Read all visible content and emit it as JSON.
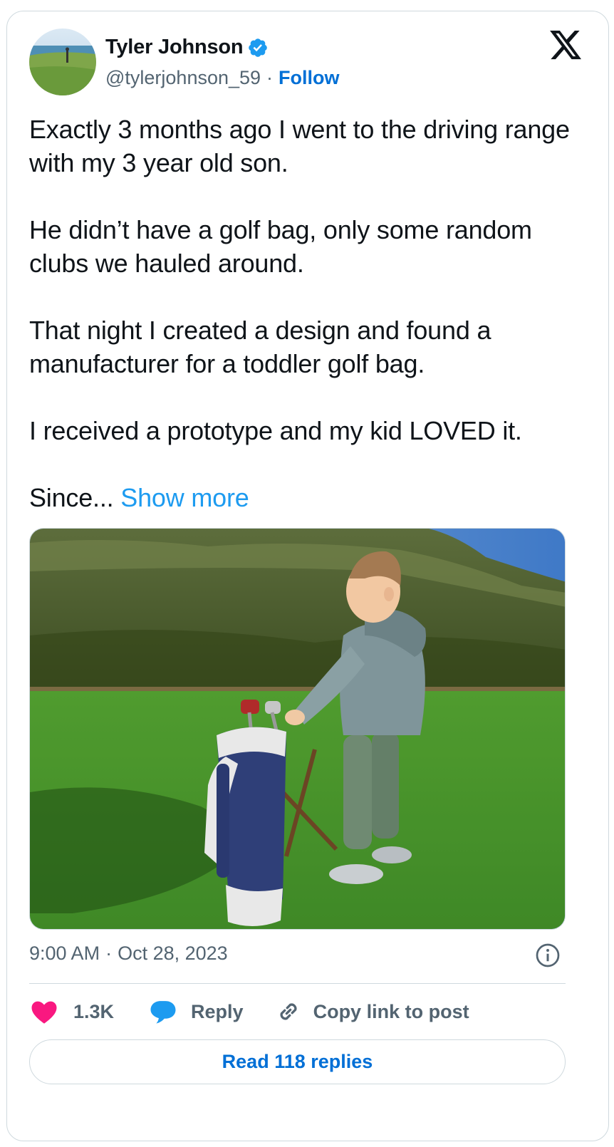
{
  "author": {
    "name": "Tyler Johnson",
    "handle": "@tylerjohnson_59",
    "separator": "·",
    "follow_label": "Follow",
    "verified": true
  },
  "post": {
    "paragraphs": [
      "Exactly 3 months ago I went to the driving range with my 3 year old son.",
      "He didn’t have a golf bag, only some random clubs we hauled around.",
      "That night I created a design and found a manufacturer for a toddler golf bag.",
      "I received a prototype and my kid LOVED it."
    ],
    "truncated_text": "Since...",
    "show_more_label": "Show more"
  },
  "meta": {
    "time": "9:00 AM",
    "separator": "·",
    "date": "Oct 28, 2023"
  },
  "actions": {
    "like_count": "1.3K",
    "reply_label": "Reply",
    "copy_label": "Copy link to post"
  },
  "read_replies_label": "Read 118 replies",
  "icons": {
    "logo": "x-logo-icon",
    "verified": "verified-badge-icon",
    "info": "info-icon",
    "like": "heart-icon",
    "reply": "reply-bubble-icon",
    "copy": "link-icon"
  },
  "colors": {
    "accent": "#1d9bf0",
    "follow": "#006fd6",
    "heart": "#f91880",
    "muted": "#536471",
    "border": "#cfd9de"
  }
}
